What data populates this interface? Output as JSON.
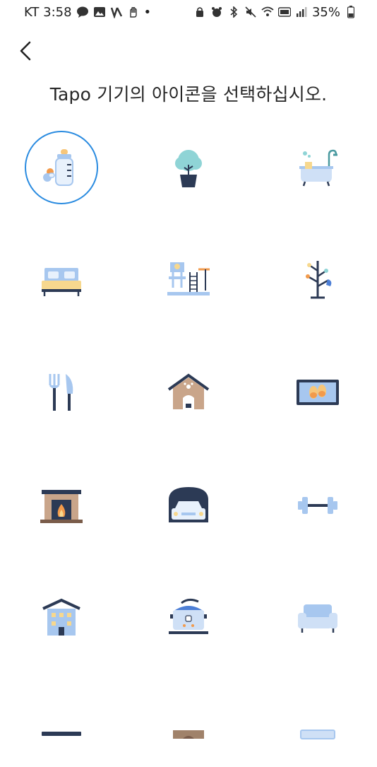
{
  "status_bar": {
    "carrier_time": "KT 3:58",
    "battery": "35%",
    "dot": "•"
  },
  "header": {
    "back_icon": "chevron-left-icon",
    "title": "Tapo 기기의 아이콘을 선택하십시오."
  },
  "colors": {
    "accent": "#2a8be0",
    "navy": "#2c3a55",
    "light_blue": "#a7c7ef",
    "yellow": "#f7d88e",
    "orange": "#f29a4b"
  },
  "icons": [
    {
      "name": "baby-bottle-icon",
      "selected": true
    },
    {
      "name": "plant-icon",
      "selected": false
    },
    {
      "name": "bathtub-icon",
      "selected": false
    },
    {
      "name": "bed-icon",
      "selected": false
    },
    {
      "name": "playground-icon",
      "selected": false
    },
    {
      "name": "coat-rack-icon",
      "selected": false
    },
    {
      "name": "fork-knife-icon",
      "selected": false
    },
    {
      "name": "dog-house-icon",
      "selected": false
    },
    {
      "name": "doormat-slippers-icon",
      "selected": false
    },
    {
      "name": "fireplace-icon",
      "selected": false
    },
    {
      "name": "garage-car-icon",
      "selected": false
    },
    {
      "name": "dumbbell-icon",
      "selected": false
    },
    {
      "name": "building-icon",
      "selected": false
    },
    {
      "name": "rice-cooker-icon",
      "selected": false
    },
    {
      "name": "sofa-icon",
      "selected": false
    },
    {
      "name": "partial-icon-1",
      "selected": false
    },
    {
      "name": "partial-icon-2",
      "selected": false
    },
    {
      "name": "partial-icon-3",
      "selected": false
    }
  ]
}
